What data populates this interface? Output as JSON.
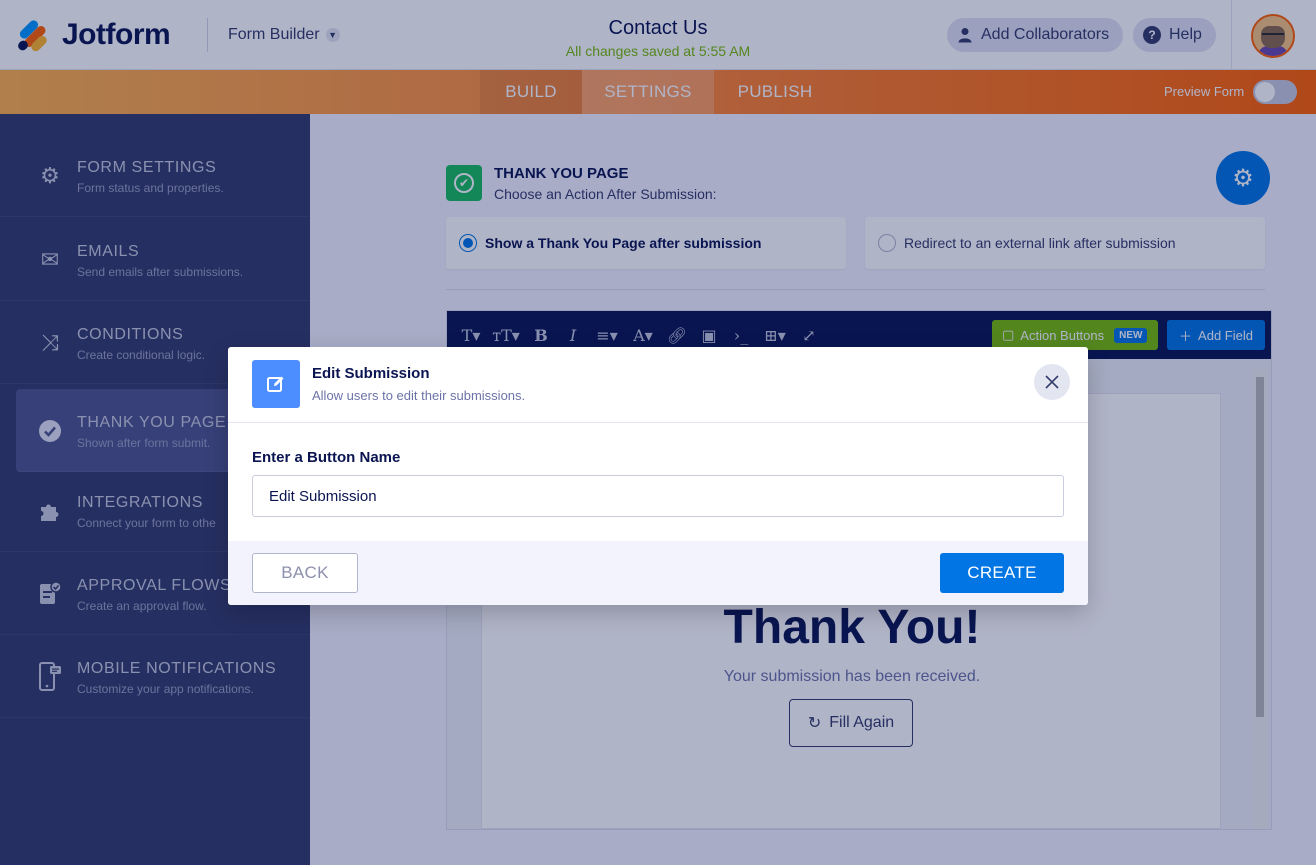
{
  "header": {
    "logo_text": "Jotform",
    "builder_menu": "Form Builder",
    "form_title": "Contact Us",
    "save_status": "All changes saved at 5:55 AM",
    "collaborators_label": "Add Collaborators",
    "help_label": "Help",
    "help_glyph": "?"
  },
  "tabs": {
    "build": "BUILD",
    "settings": "SETTINGS",
    "publish": "PUBLISH",
    "preview_label": "Preview Form",
    "preview_on": false,
    "active": "SETTINGS"
  },
  "sidebar": {
    "items": [
      {
        "title": "FORM SETTINGS",
        "desc": "Form status and properties.",
        "icon": "gear-icon"
      },
      {
        "title": "EMAILS",
        "desc": "Send emails after submissions.",
        "icon": "envelope-icon"
      },
      {
        "title": "CONDITIONS",
        "desc": "Create conditional logic.",
        "icon": "shuffle-icon"
      },
      {
        "title": "THANK YOU PAGE",
        "desc": "Shown after form submit.",
        "icon": "check-circle-icon",
        "active": true
      },
      {
        "title": "INTEGRATIONS",
        "desc": "Connect your form to othe",
        "icon": "puzzle-icon"
      },
      {
        "title": "APPROVAL FLOWS",
        "desc": "Create an approval flow.",
        "icon": "approval-doc-icon"
      },
      {
        "title": "MOBILE NOTIFICATIONS",
        "desc": "Customize your app notifications.",
        "icon": "mobile-icon"
      }
    ]
  },
  "main": {
    "section_title": "THANK YOU PAGE",
    "section_sub": "Choose an Action After Submission:",
    "option_thank_you": "Show a Thank You Page after submission",
    "option_redirect": "Redirect to an external link after submission",
    "selected_option": "option_thank_you",
    "toolbar": {
      "action_buttons": "Action Buttons",
      "new_badge": "NEW",
      "add_field": "Add Field"
    },
    "preview": {
      "heading": "Thank You!",
      "subtext": "Your submission has been received.",
      "fill_again": "Fill Again"
    }
  },
  "modal": {
    "title": "Edit Submission",
    "subtitle": "Allow users to edit their submissions.",
    "field_label": "Enter a Button Name",
    "field_value": "Edit Submission",
    "back_label": "BACK",
    "create_label": "CREATE"
  },
  "colors": {
    "brand_navy": "#0a1551",
    "accent_blue": "#0075e3",
    "sidebar_bg": "#343c6a",
    "success_green": "#18bd5b",
    "tab_orange": "#ff6100"
  }
}
